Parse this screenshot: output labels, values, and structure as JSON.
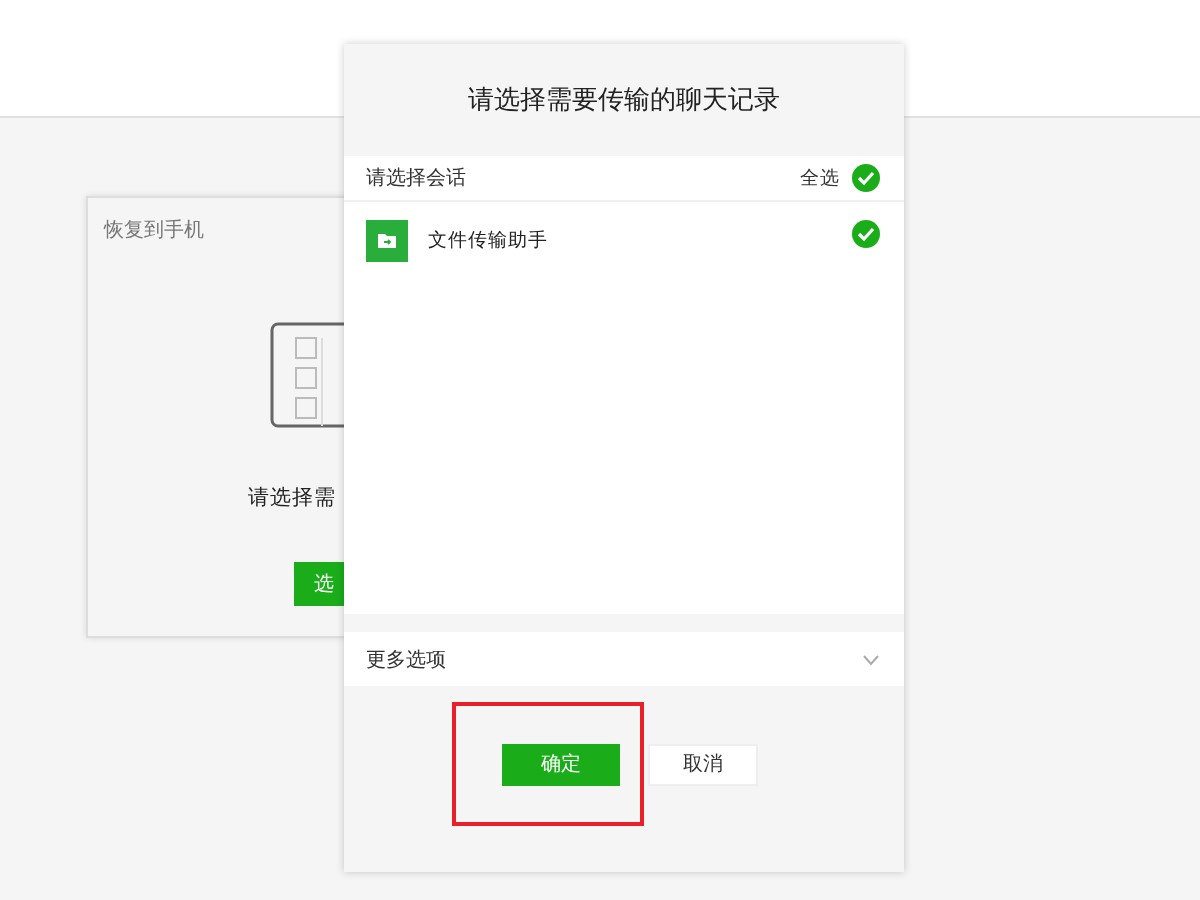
{
  "back_panel": {
    "title": "恢复到手机",
    "caption": "请选择需",
    "button": "选"
  },
  "dialog": {
    "title": "请选择需要传输的聊天记录",
    "section_label": "请选择会话",
    "select_all": {
      "label": "全选",
      "checked": true
    },
    "conversations": [
      {
        "name": "文件传输助手",
        "checked": true
      }
    ],
    "more_options": {
      "label": "更多选项",
      "expanded": false
    },
    "buttons": [
      {
        "label": "确定",
        "kind": "primary",
        "highlighted": true
      },
      {
        "label": "取消",
        "kind": "secondary",
        "highlighted": false
      }
    ]
  }
}
